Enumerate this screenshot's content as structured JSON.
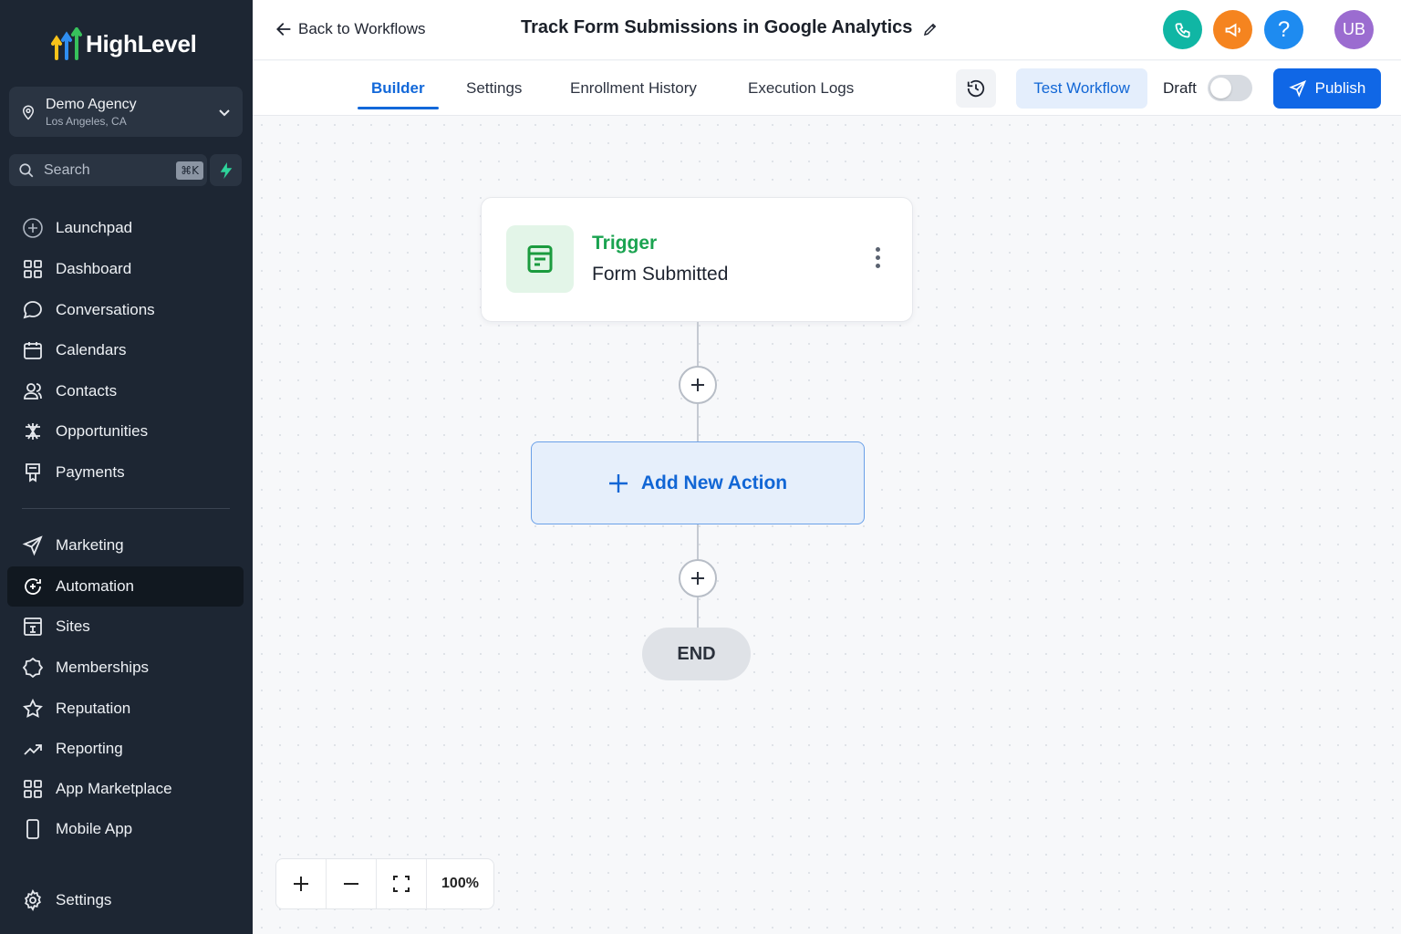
{
  "brand": {
    "name": "HighLevel"
  },
  "agency": {
    "name": "Demo Agency",
    "location": "Los Angeles, CA"
  },
  "search": {
    "label": "Search",
    "shortcut": "⌘K"
  },
  "sidebar": {
    "primary": [
      {
        "label": "Launchpad",
        "icon": "plus-circle-icon"
      },
      {
        "label": "Dashboard",
        "icon": "grid-icon"
      },
      {
        "label": "Conversations",
        "icon": "chat-bubble-icon"
      },
      {
        "label": "Calendars",
        "icon": "calendar-icon"
      },
      {
        "label": "Contacts",
        "icon": "contacts-icon"
      },
      {
        "label": "Opportunities",
        "icon": "network-icon"
      },
      {
        "label": "Payments",
        "icon": "receipt-icon"
      }
    ],
    "secondary": [
      {
        "label": "Marketing",
        "icon": "send-icon"
      },
      {
        "label": "Automation",
        "icon": "automation-icon",
        "active": true
      },
      {
        "label": "Sites",
        "icon": "sites-icon"
      },
      {
        "label": "Memberships",
        "icon": "badge-icon"
      },
      {
        "label": "Reputation",
        "icon": "star-icon"
      },
      {
        "label": "Reporting",
        "icon": "trend-icon"
      },
      {
        "label": "App Marketplace",
        "icon": "grid-icon"
      },
      {
        "label": "Mobile App",
        "icon": "phone-device-icon"
      }
    ],
    "settings": {
      "label": "Settings",
      "icon": "gear-icon"
    }
  },
  "header": {
    "back_label": "Back to Workflows",
    "title": "Track Form Submissions in Google Analytics",
    "avatar_initials": "UB",
    "colors": {
      "phone": "#10b6a4",
      "megaphone": "#f5841f",
      "help": "#1e8bf0",
      "avatar": "#9b6cd0"
    }
  },
  "tabs": [
    {
      "label": "Builder",
      "active": true
    },
    {
      "label": "Settings"
    },
    {
      "label": "Enrollment History"
    },
    {
      "label": "Execution Logs"
    }
  ],
  "toolbar": {
    "test_label": "Test Workflow",
    "draft_label": "Draft",
    "draft_enabled": false,
    "publish_label": "Publish"
  },
  "workflow": {
    "trigger_title": "Trigger",
    "trigger_name": "Form Submitted",
    "add_action_label": "Add New Action",
    "end_label": "END"
  },
  "zoom": {
    "level": "100%"
  },
  "colors": {
    "accent": "#1067e6",
    "trigger_green": "#1aa350",
    "sidebar_bg": "#1d2633"
  }
}
